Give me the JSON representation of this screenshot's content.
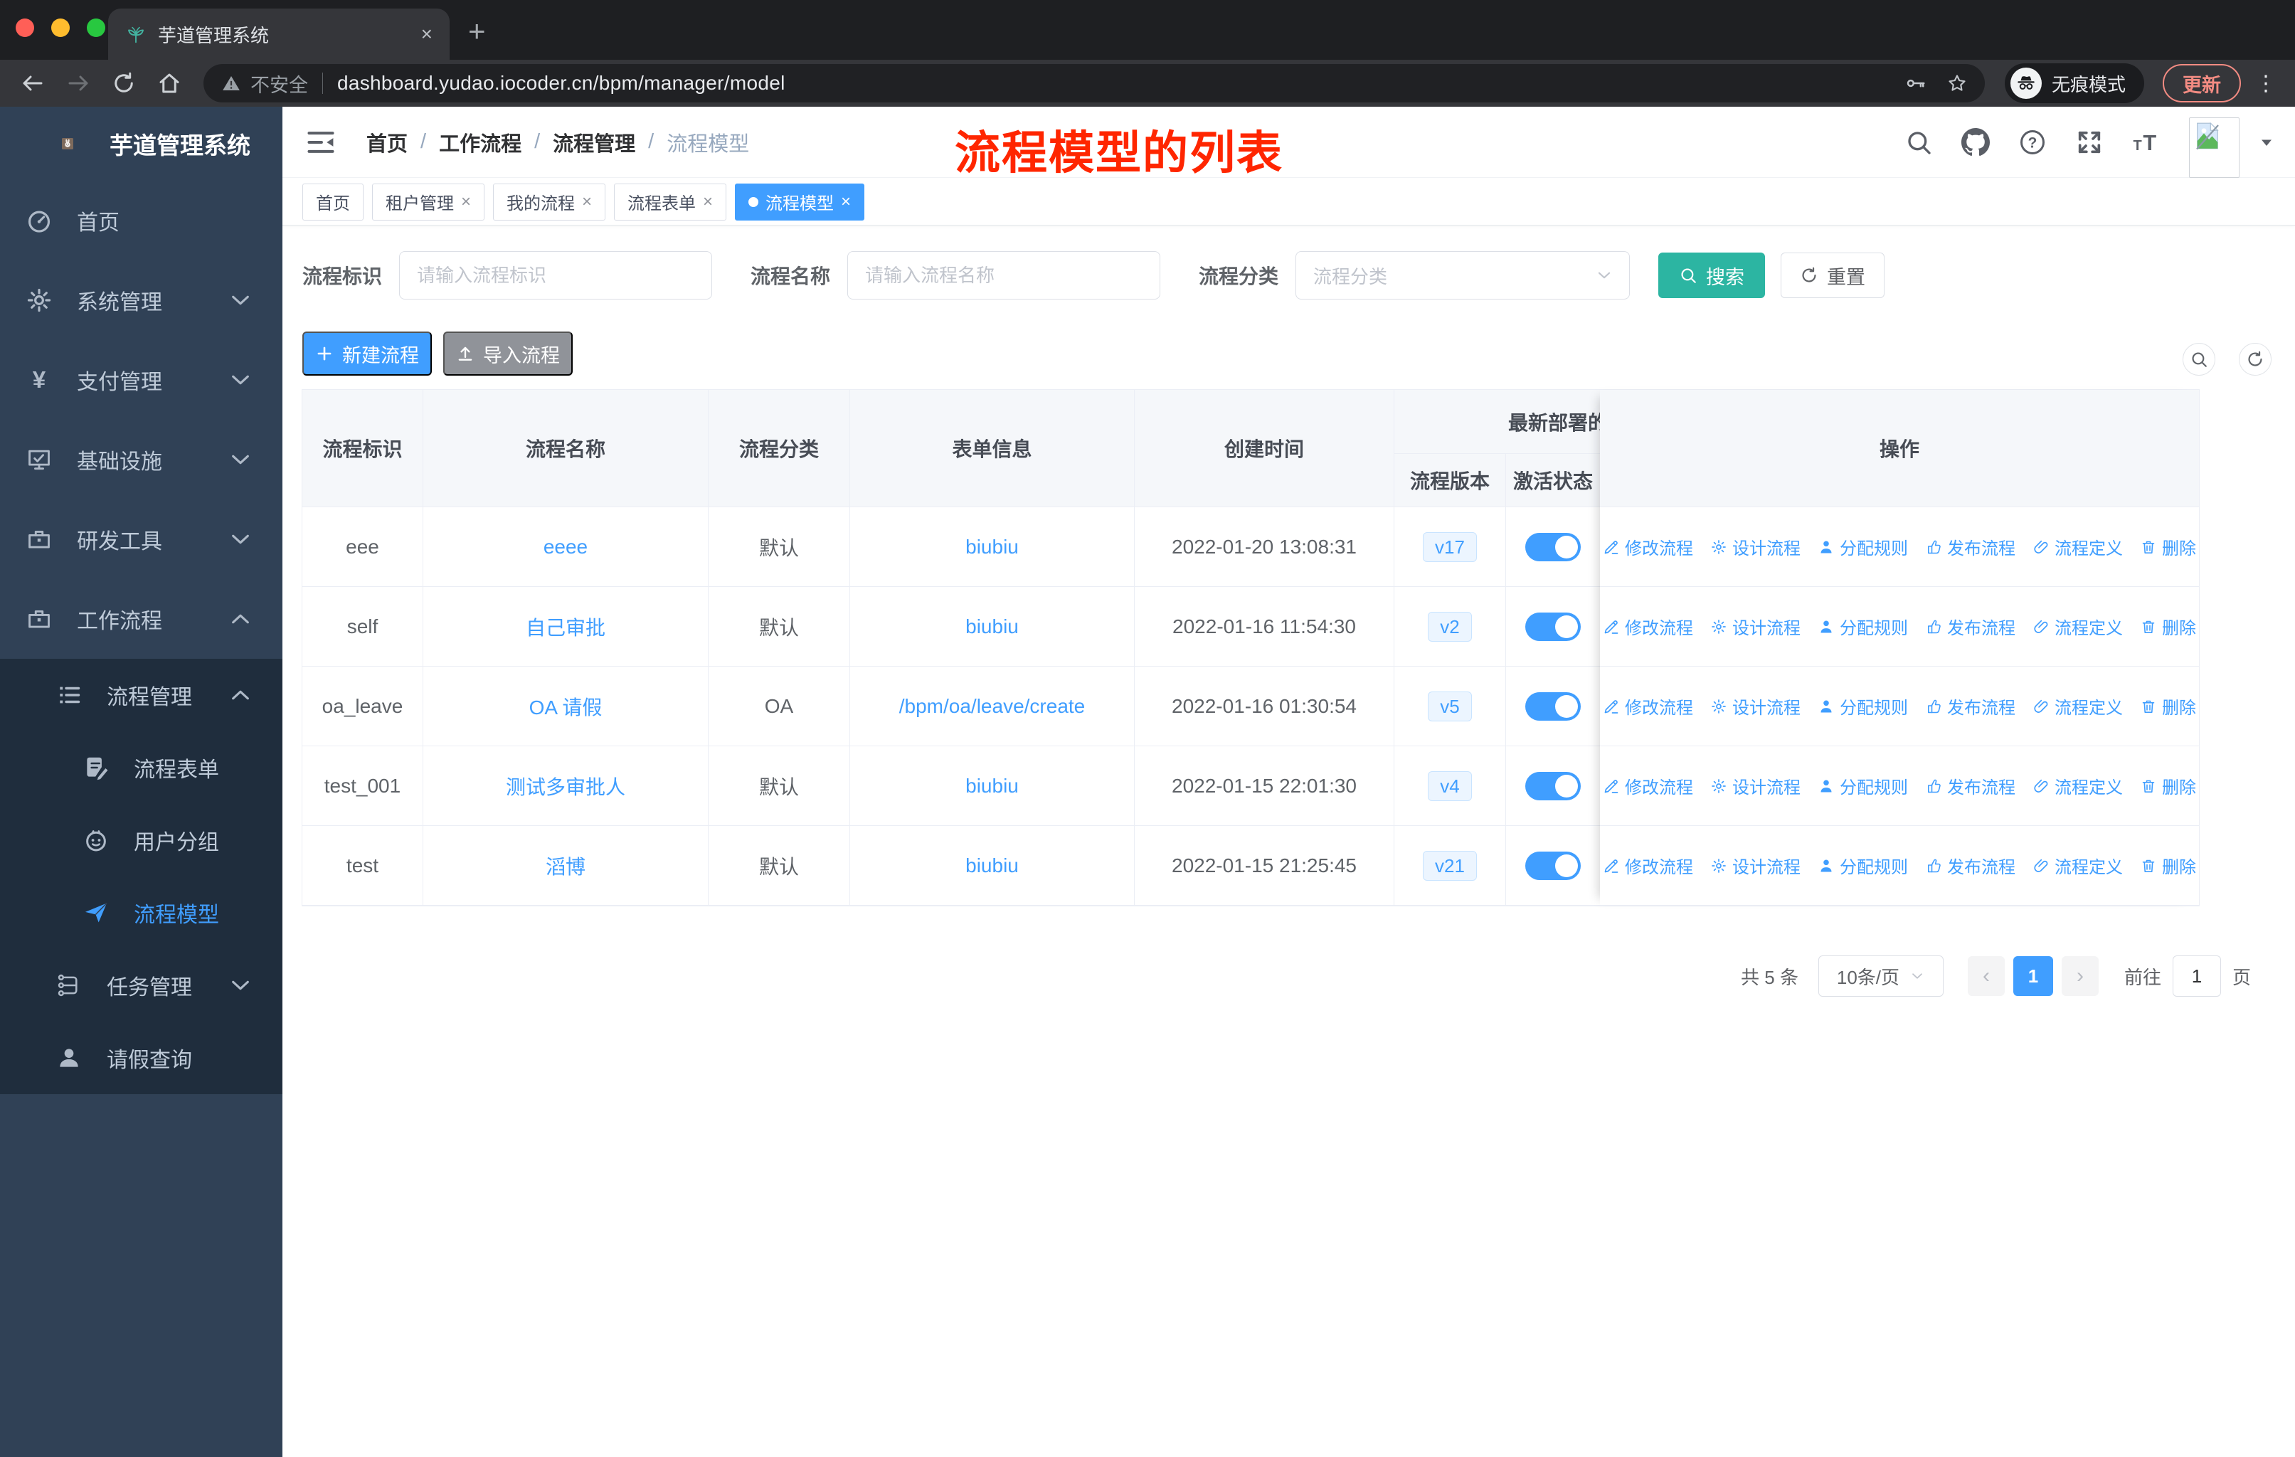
{
  "colors": {
    "primary": "#409eff",
    "teal": "#2cb5a2",
    "sidebar": "#304156",
    "submenu": "#1f2d3d",
    "annotation": "#ff2600"
  },
  "browser": {
    "tab": {
      "title": "芋道管理系统",
      "close": "×"
    },
    "new_tab": "+",
    "security_label": "不安全",
    "url": "dashboard.yudao.iocoder.cn/bpm/manager/model",
    "incognito_label": "无痕模式",
    "update_label": "更新",
    "menu_dots": "⋮"
  },
  "sidebar": {
    "logo_title": "芋道管理系统",
    "menu": [
      {
        "id": "home",
        "label": "首页",
        "icon": "dashboard-icon",
        "level": 1,
        "sub": false
      },
      {
        "id": "system",
        "label": "系统管理",
        "icon": "gear-icon",
        "level": 1,
        "chevron": "down",
        "sub": false
      },
      {
        "id": "payment",
        "label": "支付管理",
        "icon": "yen-icon",
        "level": 1,
        "chevron": "down",
        "sub": false
      },
      {
        "id": "infra",
        "label": "基础设施",
        "icon": "monitor-icon",
        "level": 1,
        "chevron": "down",
        "sub": false
      },
      {
        "id": "devtools",
        "label": "研发工具",
        "icon": "briefcase-icon",
        "level": 1,
        "chevron": "down",
        "sub": false
      },
      {
        "id": "workflow",
        "label": "工作流程",
        "icon": "briefcase-icon",
        "level": 1,
        "chevron": "up",
        "sub": false
      },
      {
        "id": "process-mgmt",
        "label": "流程管理",
        "icon": "list-icon",
        "level": 2,
        "chevron": "up",
        "sub": true
      },
      {
        "id": "process-form",
        "label": "流程表单",
        "icon": "form-icon",
        "level": 3,
        "sub": true
      },
      {
        "id": "user-group",
        "label": "用户分组",
        "icon": "users-icon",
        "level": 3,
        "sub": true
      },
      {
        "id": "process-model",
        "label": "流程模型",
        "icon": "paper-plane-icon",
        "level": 3,
        "sub": true,
        "active": true
      },
      {
        "id": "task-mgmt",
        "label": "任务管理",
        "icon": "tree-icon",
        "level": 2,
        "chevron": "down",
        "sub": true
      },
      {
        "id": "leave-query",
        "label": "请假查询",
        "icon": "person-icon",
        "level": 2,
        "sub": true
      }
    ]
  },
  "navbar": {
    "breadcrumb": [
      {
        "label": "首页",
        "current": false
      },
      {
        "label": "工作流程",
        "current": false
      },
      {
        "label": "流程管理",
        "current": false
      },
      {
        "label": "流程模型",
        "current": true
      }
    ],
    "separator": "/",
    "icons": [
      "search-icon",
      "github-icon",
      "help-icon",
      "fullscreen-icon",
      "fontsize-icon"
    ],
    "annotation": "流程模型的列表"
  },
  "tags": [
    {
      "id": "home",
      "label": "首页",
      "closable": false,
      "active": false
    },
    {
      "id": "tenant",
      "label": "租户管理",
      "closable": true,
      "active": false
    },
    {
      "id": "my-process",
      "label": "我的流程",
      "closable": true,
      "active": false
    },
    {
      "id": "process-form",
      "label": "流程表单",
      "closable": true,
      "active": false
    },
    {
      "id": "process-model",
      "label": "流程模型",
      "closable": true,
      "active": true
    }
  ],
  "filters": {
    "process_key": {
      "label": "流程标识",
      "placeholder": "请输入流程标识",
      "value": ""
    },
    "process_name": {
      "label": "流程名称",
      "placeholder": "请输入流程名称",
      "value": ""
    },
    "process_category": {
      "label": "流程分类",
      "placeholder": "流程分类",
      "value": ""
    },
    "search_label": "搜索",
    "reset_label": "重置"
  },
  "toolbar": {
    "create_label": "新建流程",
    "import_label": "导入流程"
  },
  "table": {
    "columns": [
      "流程标识",
      "流程名称",
      "流程分类",
      "表单信息",
      "创建时间"
    ],
    "group_header": "最新部署的",
    "sub_columns": [
      "流程版本",
      "激活状态"
    ],
    "op_header": "操作",
    "actions": [
      {
        "id": "edit-process",
        "label": "修改流程",
        "icon": "edit-icon"
      },
      {
        "id": "design-process",
        "label": "设计流程",
        "icon": "design-icon"
      },
      {
        "id": "assign-rule",
        "label": "分配规则",
        "icon": "assign-icon"
      },
      {
        "id": "publish-process",
        "label": "发布流程",
        "icon": "publish-icon"
      },
      {
        "id": "process-definition",
        "label": "流程定义",
        "icon": "definition-icon"
      },
      {
        "id": "delete",
        "label": "删除",
        "icon": "delete-icon"
      }
    ],
    "rows": [
      {
        "key": "eee",
        "name": "eeee",
        "category": "默认",
        "form": "biubiu",
        "created": "2022-01-20 13:08:31",
        "version": "v17",
        "active": true
      },
      {
        "key": "self",
        "name": "自己审批",
        "category": "默认",
        "form": "biubiu",
        "created": "2022-01-16 11:54:30",
        "version": "v2",
        "active": true
      },
      {
        "key": "oa_leave",
        "name": "OA 请假",
        "category": "OA",
        "form": "/bpm/oa/leave/create",
        "created": "2022-01-16 01:30:54",
        "version": "v5",
        "active": true
      },
      {
        "key": "test_001",
        "name": "测试多审批人",
        "category": "默认",
        "form": "biubiu",
        "created": "2022-01-15 22:01:30",
        "version": "v4",
        "active": true
      },
      {
        "key": "test",
        "name": "滔博",
        "category": "默认",
        "form": "biubiu",
        "created": "2022-01-15 21:25:45",
        "version": "v21",
        "active": true
      }
    ]
  },
  "pagination": {
    "total": "共 5 条",
    "page_size": "10条/页",
    "prev": "‹",
    "page": "1",
    "next": "›",
    "goto_label": "前往",
    "goto_value": "1",
    "page_suffix": "页"
  }
}
